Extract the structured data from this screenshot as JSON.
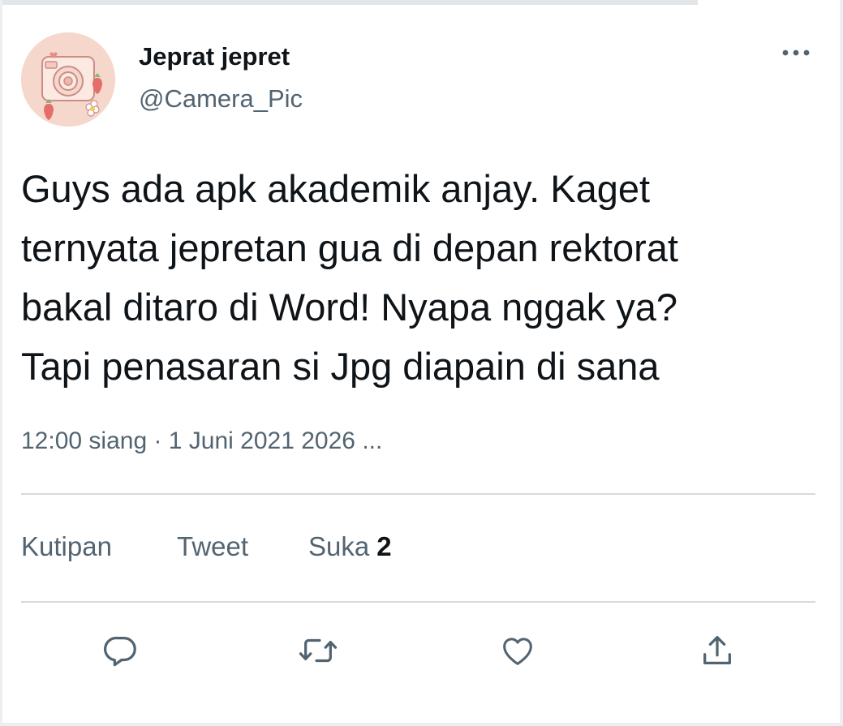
{
  "author": {
    "name": "Jeprat jepret",
    "handle": "@Camera_Pic",
    "avatar_icon": "camera-strawberry-avatar-icon"
  },
  "more_icon": "more-horizontal-icon",
  "tweet": {
    "text": "Guys ada apk akademik anjay. Kaget\nternyata jepretan gua di depan rektorat\nbakal ditaro di Word! Nyapa nggak ya?\nTapi penasaran si Jpg diapain di sana",
    "meta": "12:00 siang · 1 Juni 2021 2026 ..."
  },
  "stats": {
    "quotes_label": "Kutipan",
    "retweets_label": "Tweet",
    "likes_label": "Suka",
    "likes_count": "2"
  },
  "actions": [
    {
      "icon": "reply-icon"
    },
    {
      "icon": "retweet-icon"
    },
    {
      "icon": "like-heart-icon"
    },
    {
      "icon": "share-icon"
    }
  ],
  "colors": {
    "text_primary": "#0f1419",
    "text_secondary": "#536471",
    "divider": "#d5dadd",
    "avatar_bg": "#f6d7cb"
  }
}
